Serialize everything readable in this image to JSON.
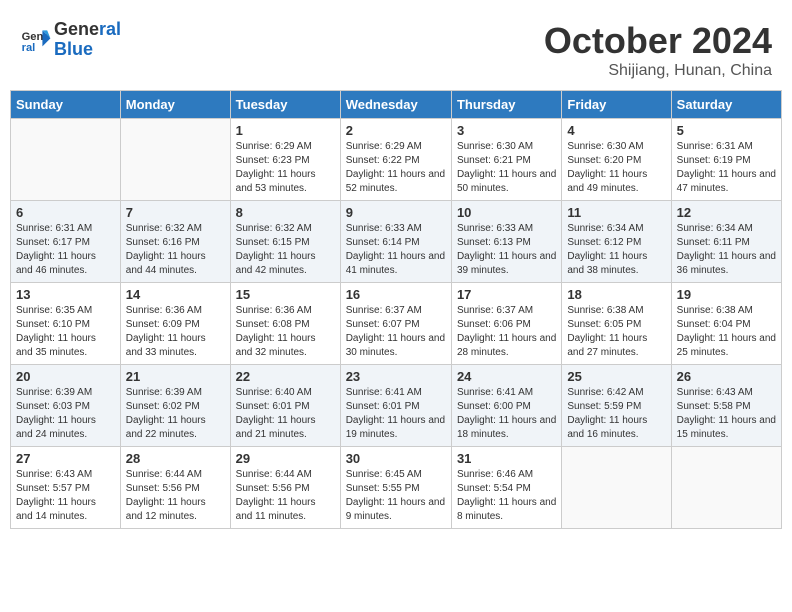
{
  "header": {
    "logo_line1": "General",
    "logo_line2": "Blue",
    "month": "October 2024",
    "location": "Shijiang, Hunan, China"
  },
  "weekdays": [
    "Sunday",
    "Monday",
    "Tuesday",
    "Wednesday",
    "Thursday",
    "Friday",
    "Saturday"
  ],
  "weeks": [
    [
      {
        "day": "",
        "info": ""
      },
      {
        "day": "",
        "info": ""
      },
      {
        "day": "1",
        "sunrise": "Sunrise: 6:29 AM",
        "sunset": "Sunset: 6:23 PM",
        "daylight": "Daylight: 11 hours and 53 minutes."
      },
      {
        "day": "2",
        "sunrise": "Sunrise: 6:29 AM",
        "sunset": "Sunset: 6:22 PM",
        "daylight": "Daylight: 11 hours and 52 minutes."
      },
      {
        "day": "3",
        "sunrise": "Sunrise: 6:30 AM",
        "sunset": "Sunset: 6:21 PM",
        "daylight": "Daylight: 11 hours and 50 minutes."
      },
      {
        "day": "4",
        "sunrise": "Sunrise: 6:30 AM",
        "sunset": "Sunset: 6:20 PM",
        "daylight": "Daylight: 11 hours and 49 minutes."
      },
      {
        "day": "5",
        "sunrise": "Sunrise: 6:31 AM",
        "sunset": "Sunset: 6:19 PM",
        "daylight": "Daylight: 11 hours and 47 minutes."
      }
    ],
    [
      {
        "day": "6",
        "sunrise": "Sunrise: 6:31 AM",
        "sunset": "Sunset: 6:17 PM",
        "daylight": "Daylight: 11 hours and 46 minutes."
      },
      {
        "day": "7",
        "sunrise": "Sunrise: 6:32 AM",
        "sunset": "Sunset: 6:16 PM",
        "daylight": "Daylight: 11 hours and 44 minutes."
      },
      {
        "day": "8",
        "sunrise": "Sunrise: 6:32 AM",
        "sunset": "Sunset: 6:15 PM",
        "daylight": "Daylight: 11 hours and 42 minutes."
      },
      {
        "day": "9",
        "sunrise": "Sunrise: 6:33 AM",
        "sunset": "Sunset: 6:14 PM",
        "daylight": "Daylight: 11 hours and 41 minutes."
      },
      {
        "day": "10",
        "sunrise": "Sunrise: 6:33 AM",
        "sunset": "Sunset: 6:13 PM",
        "daylight": "Daylight: 11 hours and 39 minutes."
      },
      {
        "day": "11",
        "sunrise": "Sunrise: 6:34 AM",
        "sunset": "Sunset: 6:12 PM",
        "daylight": "Daylight: 11 hours and 38 minutes."
      },
      {
        "day": "12",
        "sunrise": "Sunrise: 6:34 AM",
        "sunset": "Sunset: 6:11 PM",
        "daylight": "Daylight: 11 hours and 36 minutes."
      }
    ],
    [
      {
        "day": "13",
        "sunrise": "Sunrise: 6:35 AM",
        "sunset": "Sunset: 6:10 PM",
        "daylight": "Daylight: 11 hours and 35 minutes."
      },
      {
        "day": "14",
        "sunrise": "Sunrise: 6:36 AM",
        "sunset": "Sunset: 6:09 PM",
        "daylight": "Daylight: 11 hours and 33 minutes."
      },
      {
        "day": "15",
        "sunrise": "Sunrise: 6:36 AM",
        "sunset": "Sunset: 6:08 PM",
        "daylight": "Daylight: 11 hours and 32 minutes."
      },
      {
        "day": "16",
        "sunrise": "Sunrise: 6:37 AM",
        "sunset": "Sunset: 6:07 PM",
        "daylight": "Daylight: 11 hours and 30 minutes."
      },
      {
        "day": "17",
        "sunrise": "Sunrise: 6:37 AM",
        "sunset": "Sunset: 6:06 PM",
        "daylight": "Daylight: 11 hours and 28 minutes."
      },
      {
        "day": "18",
        "sunrise": "Sunrise: 6:38 AM",
        "sunset": "Sunset: 6:05 PM",
        "daylight": "Daylight: 11 hours and 27 minutes."
      },
      {
        "day": "19",
        "sunrise": "Sunrise: 6:38 AM",
        "sunset": "Sunset: 6:04 PM",
        "daylight": "Daylight: 11 hours and 25 minutes."
      }
    ],
    [
      {
        "day": "20",
        "sunrise": "Sunrise: 6:39 AM",
        "sunset": "Sunset: 6:03 PM",
        "daylight": "Daylight: 11 hours and 24 minutes."
      },
      {
        "day": "21",
        "sunrise": "Sunrise: 6:39 AM",
        "sunset": "Sunset: 6:02 PM",
        "daylight": "Daylight: 11 hours and 22 minutes."
      },
      {
        "day": "22",
        "sunrise": "Sunrise: 6:40 AM",
        "sunset": "Sunset: 6:01 PM",
        "daylight": "Daylight: 11 hours and 21 minutes."
      },
      {
        "day": "23",
        "sunrise": "Sunrise: 6:41 AM",
        "sunset": "Sunset: 6:01 PM",
        "daylight": "Daylight: 11 hours and 19 minutes."
      },
      {
        "day": "24",
        "sunrise": "Sunrise: 6:41 AM",
        "sunset": "Sunset: 6:00 PM",
        "daylight": "Daylight: 11 hours and 18 minutes."
      },
      {
        "day": "25",
        "sunrise": "Sunrise: 6:42 AM",
        "sunset": "Sunset: 5:59 PM",
        "daylight": "Daylight: 11 hours and 16 minutes."
      },
      {
        "day": "26",
        "sunrise": "Sunrise: 6:43 AM",
        "sunset": "Sunset: 5:58 PM",
        "daylight": "Daylight: 11 hours and 15 minutes."
      }
    ],
    [
      {
        "day": "27",
        "sunrise": "Sunrise: 6:43 AM",
        "sunset": "Sunset: 5:57 PM",
        "daylight": "Daylight: 11 hours and 14 minutes."
      },
      {
        "day": "28",
        "sunrise": "Sunrise: 6:44 AM",
        "sunset": "Sunset: 5:56 PM",
        "daylight": "Daylight: 11 hours and 12 minutes."
      },
      {
        "day": "29",
        "sunrise": "Sunrise: 6:44 AM",
        "sunset": "Sunset: 5:56 PM",
        "daylight": "Daylight: 11 hours and 11 minutes."
      },
      {
        "day": "30",
        "sunrise": "Sunrise: 6:45 AM",
        "sunset": "Sunset: 5:55 PM",
        "daylight": "Daylight: 11 hours and 9 minutes."
      },
      {
        "day": "31",
        "sunrise": "Sunrise: 6:46 AM",
        "sunset": "Sunset: 5:54 PM",
        "daylight": "Daylight: 11 hours and 8 minutes."
      },
      {
        "day": "",
        "info": ""
      },
      {
        "day": "",
        "info": ""
      }
    ]
  ]
}
